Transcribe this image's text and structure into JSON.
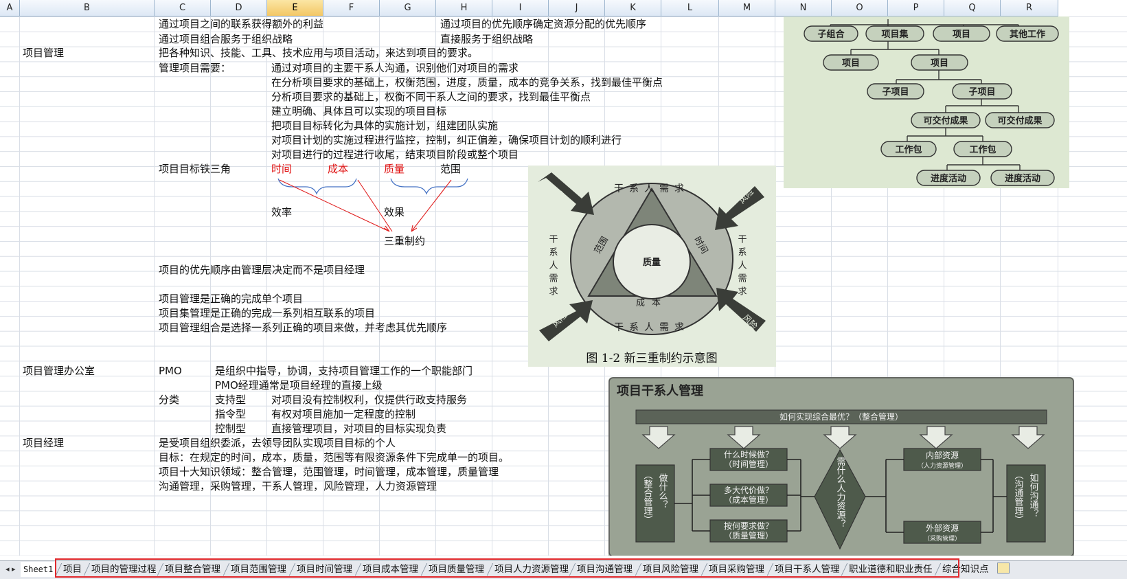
{
  "columns": [
    "A",
    "B",
    "C",
    "D",
    "E",
    "F",
    "G",
    "H",
    "I",
    "J",
    "K",
    "L",
    "M",
    "N",
    "O",
    "P",
    "Q",
    "R"
  ],
  "active_column": "E",
  "cells": {
    "r1c": "通过项目之间的联系获得额外的利益",
    "r1h": "通过项目的优先顺序确定资源分配的优先顺序",
    "r2c": "通过项目组合服务于组织战略",
    "r2h": "直接服务于组织战略",
    "r3b": "项目管理",
    "r3c": "把各种知识、技能、工具、技术应用与项目活动，来达到项目的要求。",
    "r4c": "管理项目需要：",
    "r4e": "通过对项目的主要干系人沟通，识别他们对项目的需求",
    "r5e": "在分析项目要求的基础上，权衡范围，进度，质量，成本的竞争关系，找到最佳平衡点",
    "r6e": "分析项目要求的基础上，权衡不同干系人之间的要求，找到最佳平衡点",
    "r7e": "建立明确、具体且可以实现的项目目标",
    "r8e": "把项目目标转化为具体的实施计划，组建团队实施",
    "r9e": "对项目计划的实施过程进行监控，控制，纠正偏差，确保项目计划的顺利进行",
    "r10e": "对项目进行的过程进行收尾，结束项目阶段或整个项目",
    "r11c": "项目目标铁三角",
    "r11e": "时间",
    "r11f": "成本",
    "r11g": "质量",
    "r11h": "范围",
    "r13e": "效率",
    "r13g": "效果",
    "r15g": "三重制约",
    "r17c": "项目的优先顺序由管理层决定而不是项目经理",
    "r19c": "项目管理是正确的完成单个项目",
    "r20c": "项目集管理是正确的完成一系列相互联系的项目",
    "r21c": "项目管理组合是选择一系列正确的项目来做，并考虑其优先顺序",
    "r24b": "项目管理办公室",
    "r24c": "PMO",
    "r24d": "是组织中指导，协调，支持项目管理工作的一个职能部门",
    "r25d": "PMO经理通常是项目经理的直接上级",
    "r26c": "分类",
    "r26d": "支持型",
    "r26e": "对项目没有控制权利，仅提供行政支持服务",
    "r27d": "指令型",
    "r27e": "有权对项目施加一定程度的控制",
    "r28d": "控制型",
    "r28e": "直接管理项目，对项目的目标实现负责",
    "r29b": "项目经理",
    "r29c": "是受项目组织委派，去领导团队实现项目目标的个人",
    "r30c": "目标：在规定的时间，成本，质量，范围等有限资源条件下完成单一的项目。",
    "r31c": "项目十大知识领域：整合管理，范围管理，时间管理，成本管理，质量管理",
    "r32c": "沟通管理，采购管理，干系人管理，风险管理，人力资源管理"
  },
  "hierarchy_image": {
    "row1": [
      "子组合",
      "项目集",
      "项目",
      "其他工作"
    ],
    "row2": [
      "项目",
      "项目"
    ],
    "row3": [
      "子项目",
      "子项目"
    ],
    "row4": [
      "可交付成果",
      "可交付成果"
    ],
    "row5": [
      "工作包",
      "工作包"
    ],
    "row6": [
      "进度活动",
      "进度活动"
    ]
  },
  "constraint_image": {
    "caption": "图 1-2 新三重制约示意图",
    "center": "质量",
    "left_side": "范围",
    "right_side": "时间",
    "bottom_side": "成本",
    "stakeholder_top": "干系人需求",
    "stakeholder_bottom": "干系人需求",
    "stakeholder_left": "干系人需求",
    "stakeholder_right": "干系人需求",
    "risk": "风险"
  },
  "stakeholder_image": {
    "title": "项目干系人管理",
    "banner": "如何实现综合最优？（整合管理）",
    "left_box": "（整合管理）",
    "left_q": "做什么？",
    "q1": "什么时候做？",
    "q1_sub": "（时间管理）",
    "q2": "多大代价做？",
    "q2_sub": "（成本管理）",
    "q3": "按何要求做？",
    "q3_sub": "（质量管理）",
    "diamond": "需什么人力资源？",
    "internal": "内部资源",
    "internal_sub": "（人力资源管理）",
    "external": "外部资源",
    "external_sub": "（采购管理）",
    "right_q": "如何沟通？",
    "right_box": "（沟通管理）"
  },
  "tabs": {
    "nav": "◂ ▸",
    "items": [
      "Sheet1",
      "项目",
      "项目的管理过程",
      "项目整合管理",
      "项目范围管理",
      "项目时间管理",
      "项目成本管理",
      "项目质量管理",
      "项目人力资源管理",
      "项目沟通管理",
      "项目风险管理",
      "项目采购管理",
      "项目干系人管理",
      "职业道德和职业责任",
      "综合知识点"
    ]
  }
}
